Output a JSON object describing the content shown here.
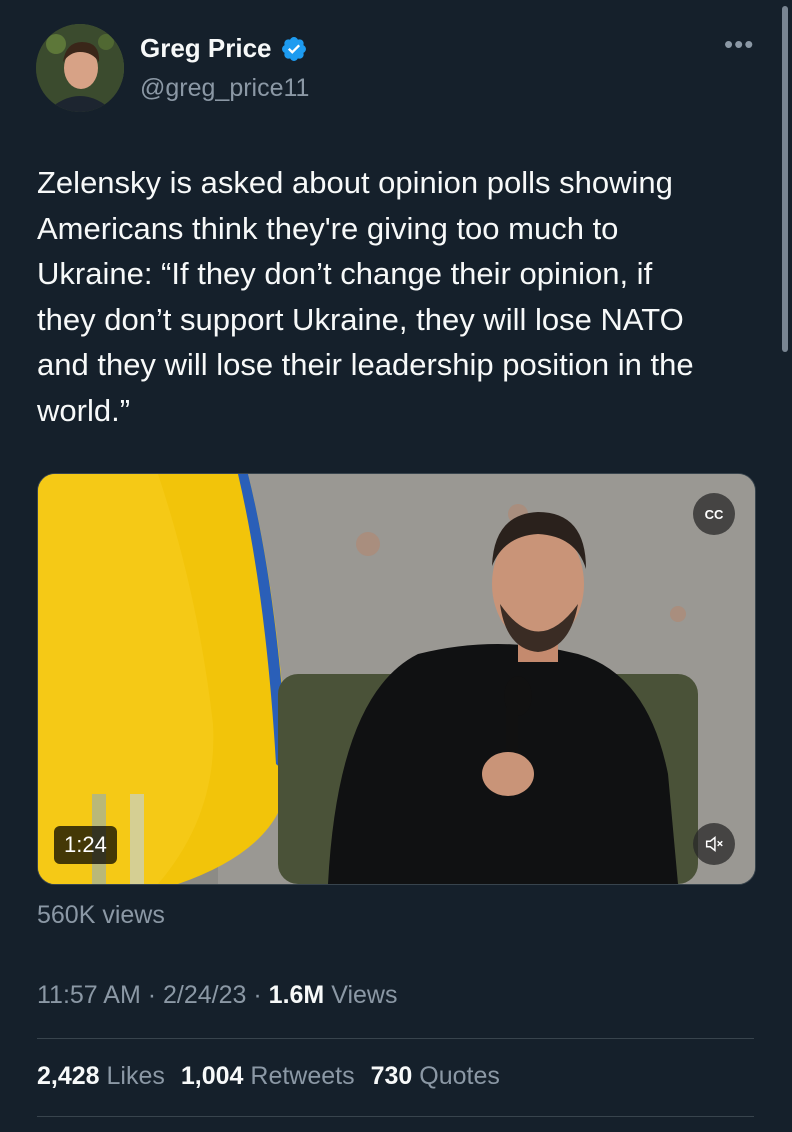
{
  "author": {
    "name": "Greg Price",
    "handle": "@greg_price11"
  },
  "tweet": {
    "text": "Zelensky is asked about opinion polls showing\nAmericans think they're giving too much to\nUkraine: “If they don’t change their opinion, if\nthey don’t support Ukraine, they will lose NATO\nand they will lose their leadership position in the\nworld.”"
  },
  "video": {
    "duration": "1:24",
    "views": "560K views",
    "cc_label": "CC"
  },
  "meta": {
    "time": "11:57 AM",
    "sep1": "·",
    "date": "2/24/23",
    "sep2": "·",
    "views_count": "1.6M",
    "views_label": "Views"
  },
  "stats": {
    "likes_count": "2,428",
    "likes_label": "Likes",
    "retweets_count": "1,004",
    "retweets_label": "Retweets",
    "quotes_count": "730",
    "quotes_label": "Quotes"
  },
  "icons": {
    "more": "more-horizontal-icon",
    "verified": "verified-badge-icon",
    "captions": "captions-icon",
    "mute": "mute-icon"
  },
  "colors": {
    "background": "#15202b",
    "secondary_text": "#8b98a5",
    "verified_blue": "#1d9bf0",
    "divider": "#38444d"
  }
}
